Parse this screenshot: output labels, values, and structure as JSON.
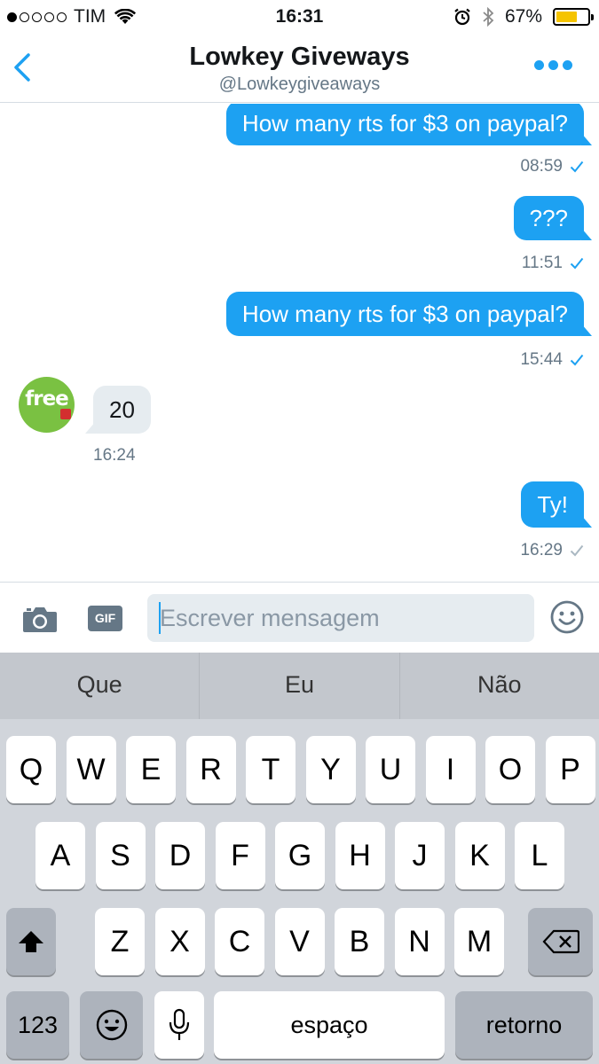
{
  "status_bar": {
    "carrier": "TIM",
    "time": "16:31",
    "battery": "67%",
    "battery_level": 0.67
  },
  "header": {
    "title": "Lowkey Giveways",
    "handle": "@Lowkeygiveaways"
  },
  "messages": [
    {
      "text": "How many rts for $3 on paypal?",
      "time": "08:59"
    },
    {
      "text": "???",
      "time": "11:51"
    },
    {
      "text": "How many rts for $3 on paypal?",
      "time": "15:44"
    },
    {
      "text": "20",
      "time": "16:24"
    },
    {
      "text": "Ty!",
      "time": "16:29"
    }
  ],
  "avatar": {
    "text": "free",
    "color": "#7ac142"
  },
  "composer": {
    "gif_label": "GIF",
    "placeholder": "Escrever mensagem"
  },
  "keyboard": {
    "suggestions": [
      "Que",
      "Eu",
      "Não"
    ],
    "row1": [
      "Q",
      "W",
      "E",
      "R",
      "T",
      "Y",
      "U",
      "I",
      "O",
      "P"
    ],
    "row2": [
      "A",
      "S",
      "D",
      "F",
      "G",
      "H",
      "J",
      "K",
      "L"
    ],
    "row3": [
      "Z",
      "X",
      "C",
      "V",
      "B",
      "N",
      "M"
    ],
    "numbers_label": "123",
    "space_label": "espaço",
    "return_label": "retorno"
  },
  "colors": {
    "accent": "#1da1f2",
    "incoming_bubble": "#e6ecf0",
    "muted_text": "#657786"
  }
}
